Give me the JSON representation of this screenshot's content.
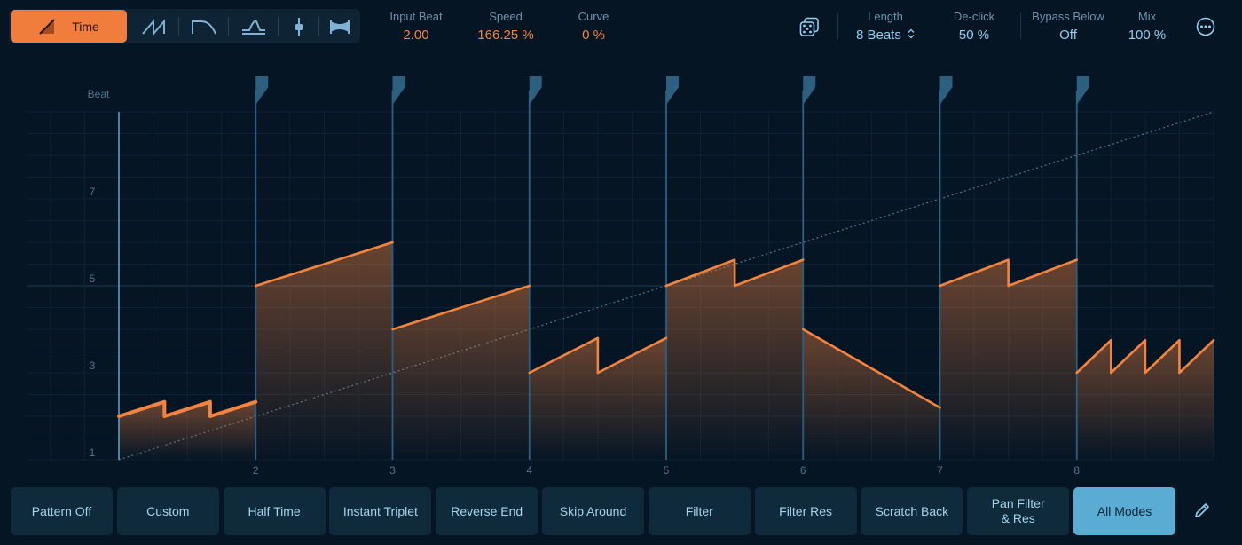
{
  "modes": {
    "active_label": "Time",
    "items": [
      {
        "name": "time",
        "icon": "time-ramp-icon"
      },
      {
        "name": "speed",
        "icon": "double-ramp-icon"
      },
      {
        "name": "stop",
        "icon": "slow-down-curve-icon"
      },
      {
        "name": "volume",
        "icon": "peak-curve-icon"
      },
      {
        "name": "filter",
        "icon": "slider-icon"
      },
      {
        "name": "pan",
        "icon": "bowtie-icon"
      }
    ]
  },
  "params": {
    "input_beat": {
      "label": "Input Beat",
      "value": "2.00"
    },
    "speed": {
      "label": "Speed",
      "value": "166.25 %"
    },
    "curve": {
      "label": "Curve",
      "value": "0 %"
    },
    "length": {
      "label": "Length",
      "value": "8 Beats"
    },
    "declick": {
      "label": "De-click",
      "value": "50 %"
    },
    "bypass": {
      "label": "Bypass Below",
      "value": "Off"
    },
    "mix": {
      "label": "Mix",
      "value": "100 %"
    }
  },
  "graph": {
    "y_axis_title": "Beat",
    "y_ticks": [
      "1",
      "3",
      "5",
      "7"
    ],
    "x_ticks": [
      "2",
      "3",
      "4",
      "5",
      "6",
      "7",
      "8"
    ],
    "y_min": 1,
    "y_max": 9,
    "x_min": 1,
    "x_max": 9,
    "segments": [
      [
        [
          1,
          2
        ],
        [
          1.333,
          2.333
        ],
        [
          1.333,
          2
        ],
        [
          1.667,
          2.333
        ],
        [
          1.667,
          2
        ],
        [
          2,
          2.333
        ]
      ],
      [
        [
          2,
          5
        ],
        [
          3,
          6
        ]
      ],
      [
        [
          3,
          4
        ],
        [
          4,
          5
        ]
      ],
      [
        [
          4,
          3
        ],
        [
          4.5,
          3.8
        ],
        [
          4.5,
          3
        ],
        [
          5,
          3.8
        ]
      ],
      [
        [
          5,
          5
        ],
        [
          5.5,
          5.6
        ],
        [
          5.5,
          5
        ],
        [
          6,
          5.6
        ]
      ],
      [
        [
          6,
          4
        ],
        [
          7,
          2.2
        ]
      ],
      [
        [
          7,
          5
        ],
        [
          7.5,
          5.6
        ],
        [
          7.5,
          5
        ],
        [
          8,
          5.6
        ]
      ],
      [
        [
          8,
          3
        ],
        [
          8.25,
          3.75
        ],
        [
          8.25,
          3
        ],
        [
          8.5,
          3.75
        ],
        [
          8.5,
          3
        ],
        [
          8.75,
          3.75
        ],
        [
          8.75,
          3
        ],
        [
          9,
          3.75
        ]
      ]
    ],
    "accent_color": "#f3843f",
    "marker_color": "#2d5f80"
  },
  "presets": [
    {
      "label": "Pattern Off"
    },
    {
      "label": "Custom"
    },
    {
      "label": "Half Time"
    },
    {
      "label": "Instant Triplet"
    },
    {
      "label": "Reverse End"
    },
    {
      "label": "Skip Around"
    },
    {
      "label": "Filter"
    },
    {
      "label": "Filter Res"
    },
    {
      "label": "Scratch Back"
    },
    {
      "label": "Pan Filter\n& Res"
    },
    {
      "label": "All Modes",
      "active": true
    }
  ]
}
